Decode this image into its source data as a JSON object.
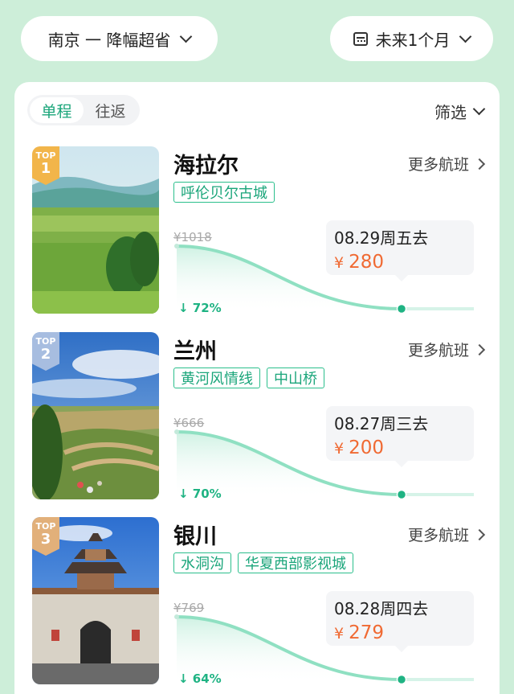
{
  "header": {
    "route_label": "南京 一 降幅超省",
    "date_label": "未来1个月"
  },
  "tabs": [
    {
      "label": "单程",
      "active": true
    },
    {
      "label": "往返",
      "active": false
    }
  ],
  "filter_label": "筛选",
  "more_label": "更多航班",
  "currency": "¥",
  "badge_text": "TOP",
  "destinations": [
    {
      "rank": "1",
      "city": "海拉尔",
      "tags": [
        "呼伦贝尔古城"
      ],
      "original_price": "¥1018",
      "drop": "72%",
      "date": "08.29周五去",
      "price": "280",
      "badge_color": "#f2b54a"
    },
    {
      "rank": "2",
      "city": "兰州",
      "tags": [
        "黄河风情线",
        "中山桥"
      ],
      "original_price": "¥666",
      "drop": "70%",
      "date": "08.27周三去",
      "price": "200",
      "badge_color": "#a7bde0"
    },
    {
      "rank": "3",
      "city": "银川",
      "tags": [
        "水洞沟",
        "华夏西部影视城"
      ],
      "original_price": "¥769",
      "drop": "64%",
      "date": "08.28周四去",
      "price": "279",
      "badge_color": "#e2b07a"
    }
  ],
  "colors": {
    "accent": "#1aa57a",
    "price": "#f06a33",
    "background": "#cdeed9"
  }
}
